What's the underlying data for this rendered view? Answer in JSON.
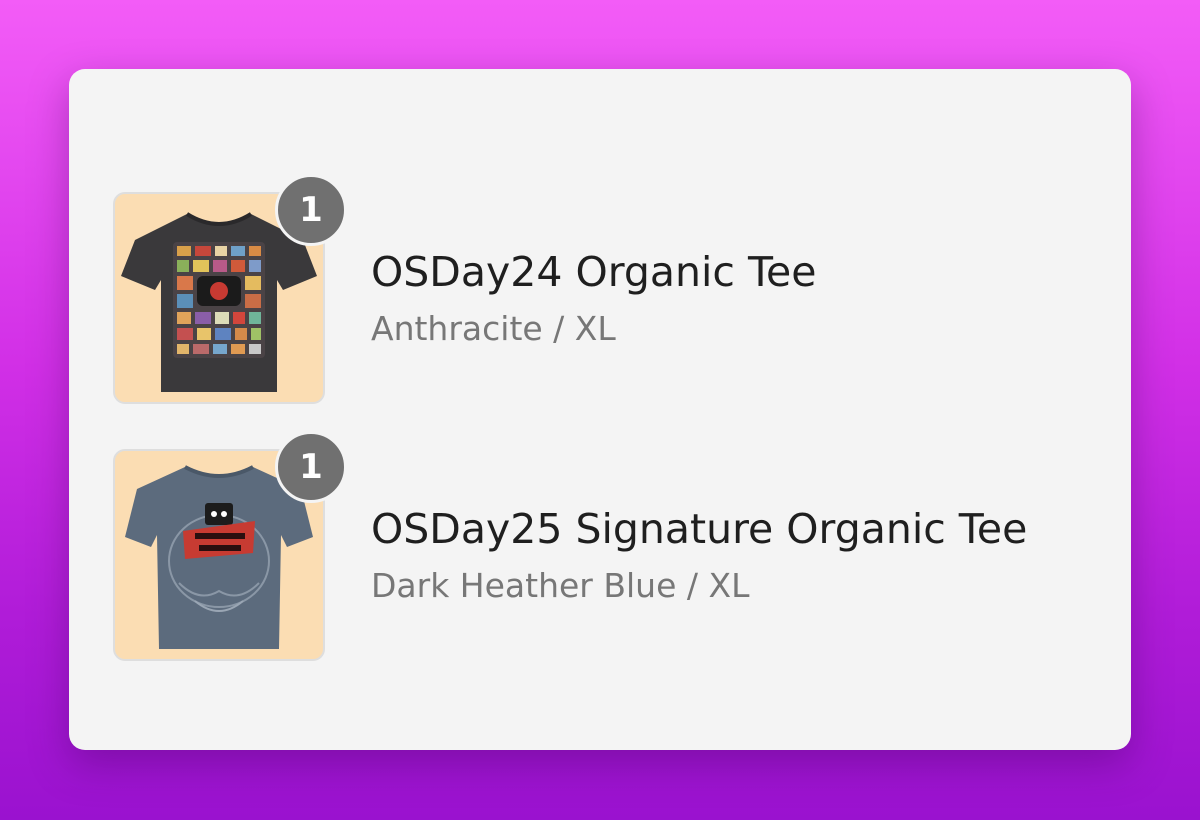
{
  "colors": {
    "background_top": "#f35cf7",
    "background_bottom": "#9a12cf",
    "card": "#f4f4f4",
    "thumbnail_bg": "#fbddb3",
    "badge": "#707070",
    "title": "#1f1f1f",
    "variant": "#777777"
  },
  "order_items": [
    {
      "quantity": "1",
      "title": "OSDay24 Organic Tee",
      "variant": "Anthracite / XL",
      "image_icon": "tshirt-anthracite-icon",
      "shirt_color": "#3a393b"
    },
    {
      "quantity": "1",
      "title": "OSDay25 Signature Organic Tee",
      "variant": "Dark Heather Blue / XL",
      "image_icon": "tshirt-dark-heather-blue-icon",
      "shirt_color": "#5c6b7d"
    }
  ]
}
